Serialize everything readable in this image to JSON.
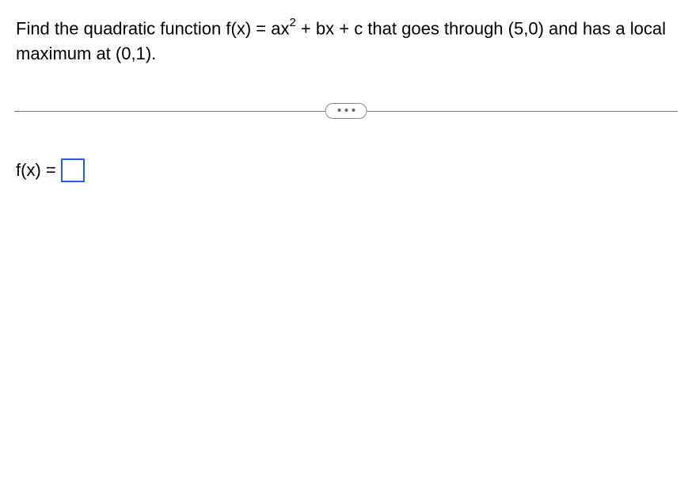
{
  "question": {
    "prefix": "Find the quadratic function f(x) = ax",
    "exponent": "2",
    "suffix": " + bx + c that goes through (5,0) and has a local maximum at (0,1)."
  },
  "answer": {
    "label": "f(x) =",
    "value": ""
  }
}
